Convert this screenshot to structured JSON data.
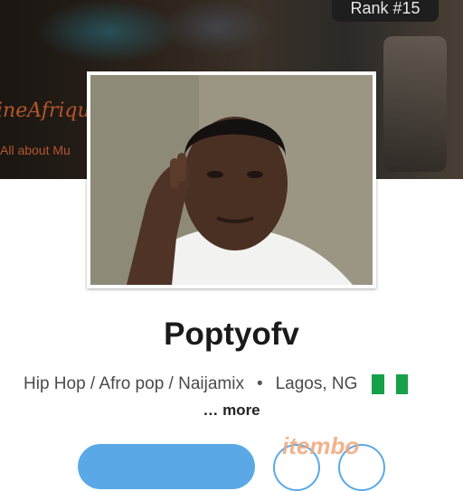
{
  "banner": {
    "logo_text": "ineAfriqu",
    "tagline": "All about Mu"
  },
  "rank": {
    "label": "Rank #15"
  },
  "profile": {
    "name": "Poptyofv",
    "genres": "Hip Hop / Afro pop / Naijamix",
    "separator": "•",
    "location": "Lagos, NG",
    "flag_colors": [
      "#17a04a",
      "#ffffff",
      "#17a04a"
    ],
    "more_label": "… more"
  },
  "watermark": {
    "text": "itembo"
  },
  "colors": {
    "accent": "#5aa9e6",
    "text": "#1a1a1a"
  }
}
